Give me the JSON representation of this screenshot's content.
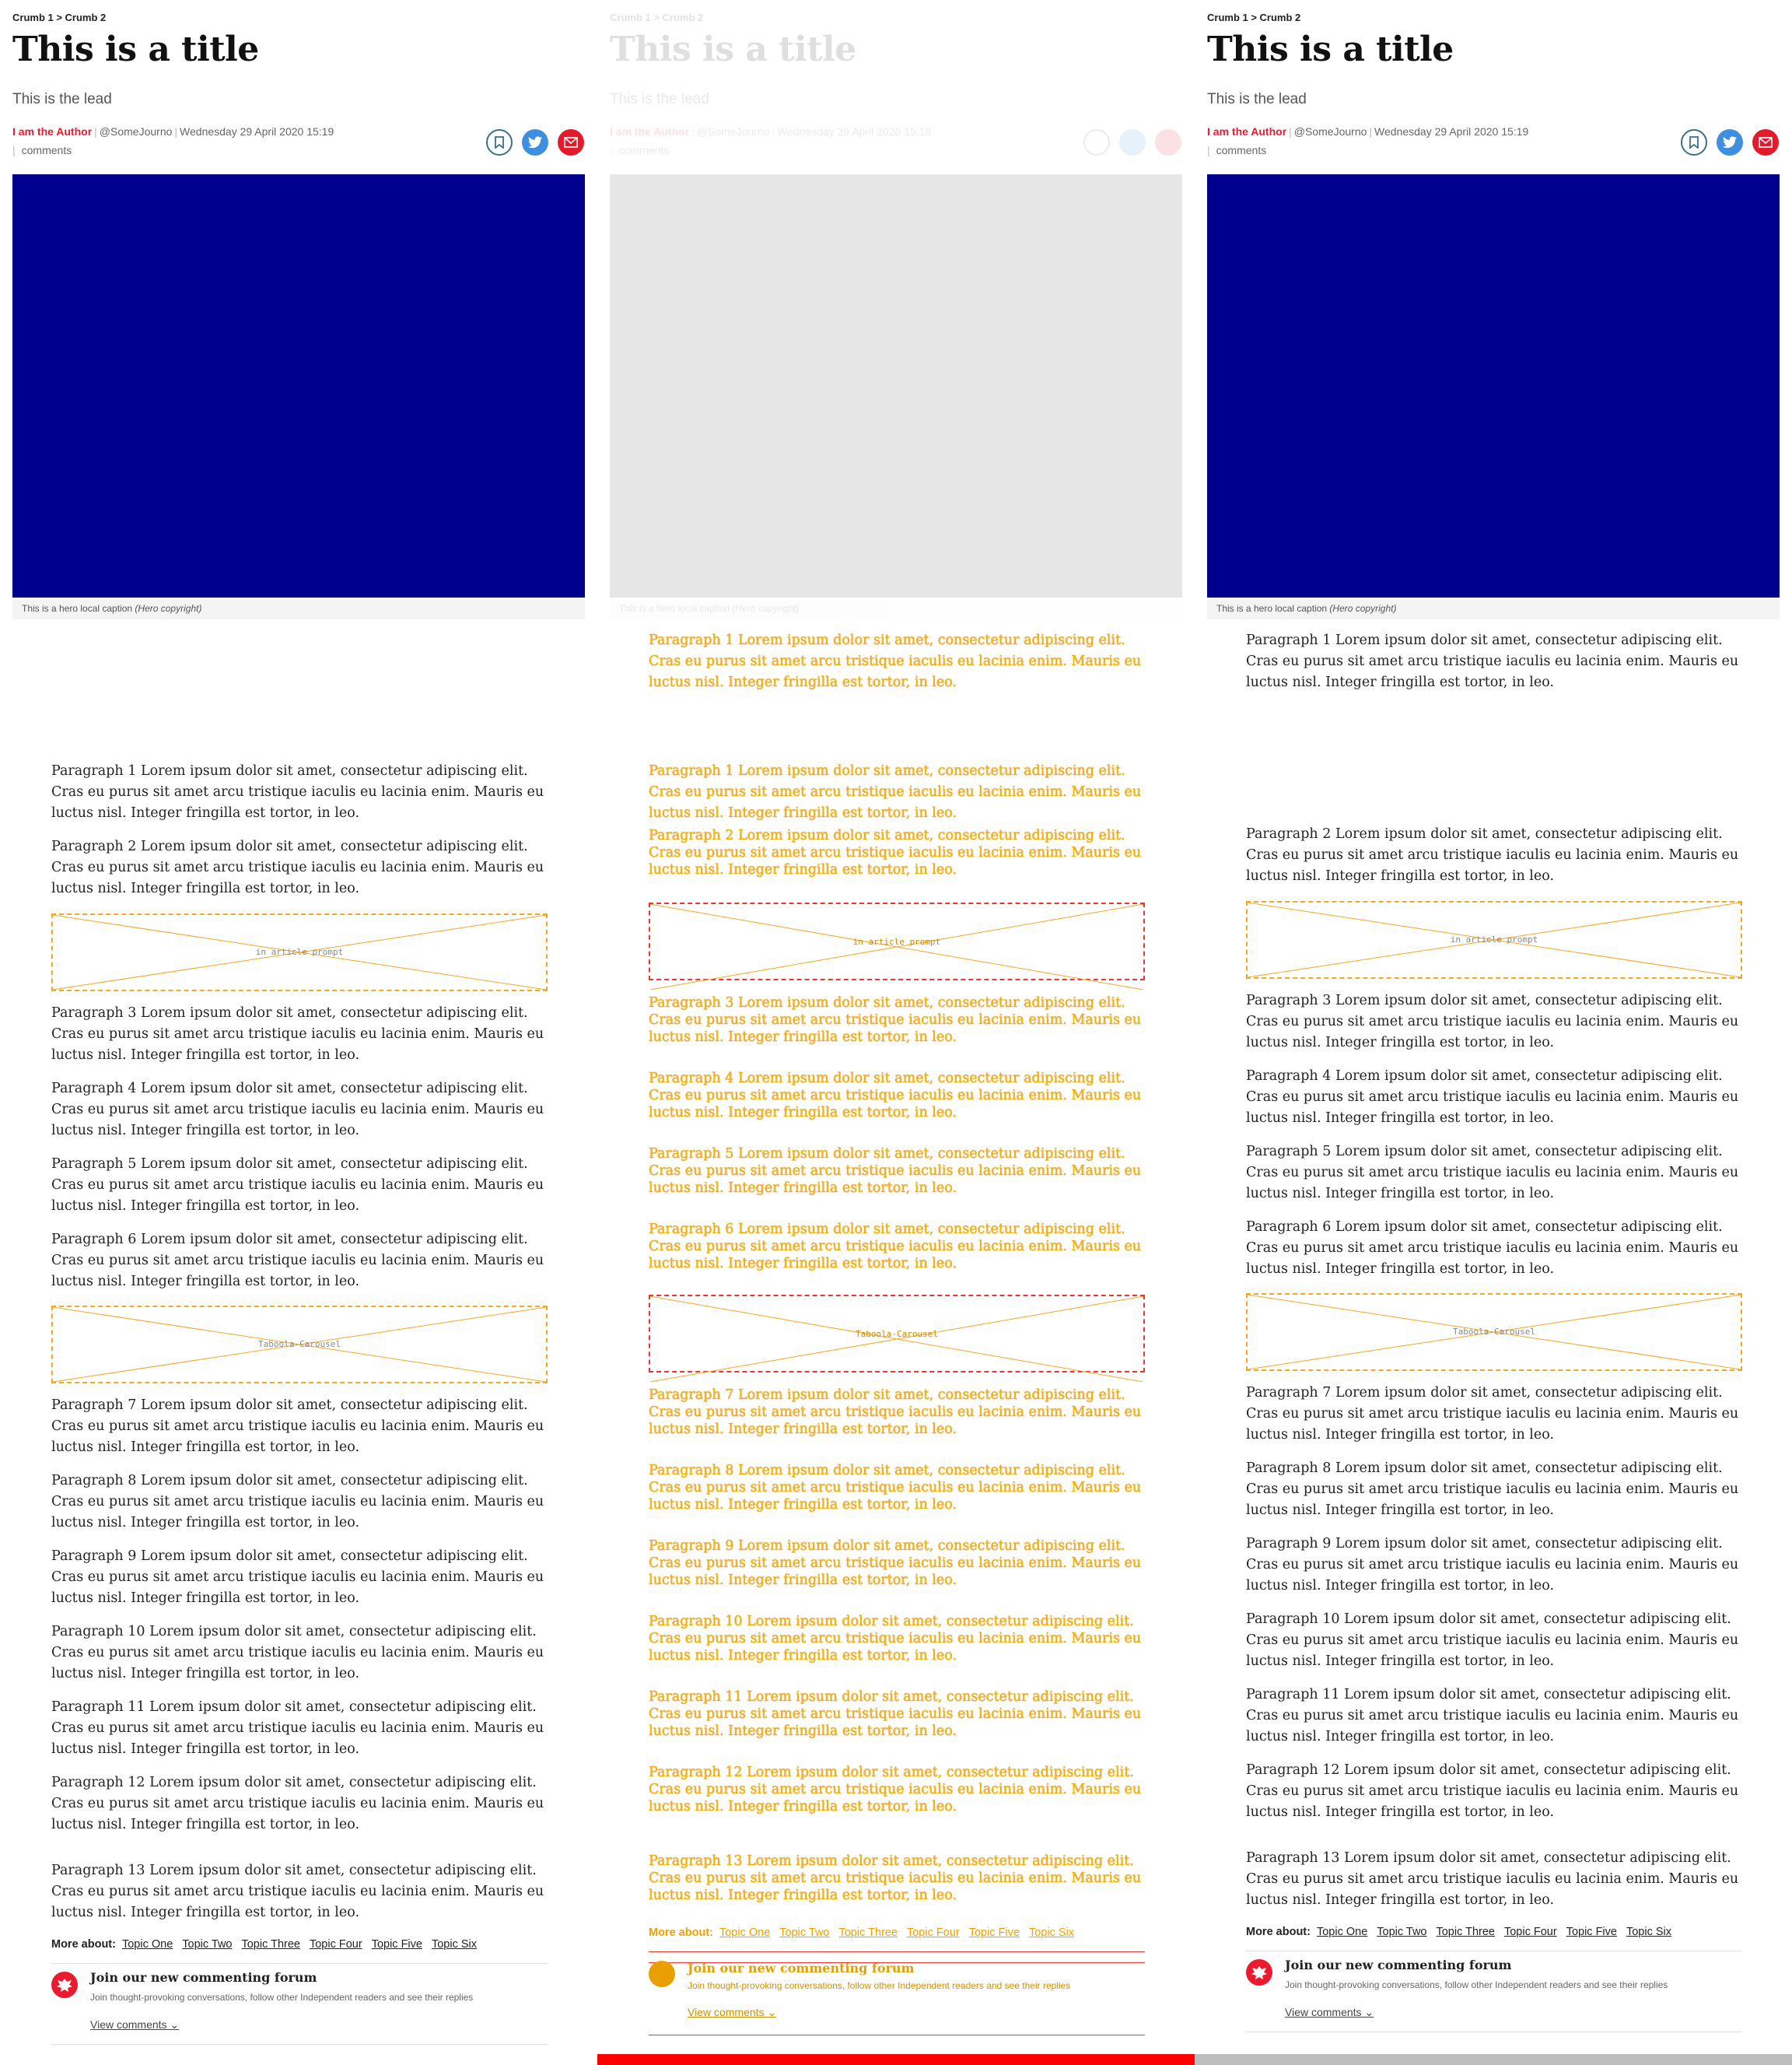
{
  "article": {
    "breadcrumb": "Crumb 1 > Crumb 2",
    "title": "This is a title",
    "lead": "This is the lead",
    "author": "I am the Author",
    "handle": "@SomeJourno",
    "date": "Wednesday 29 April 2020 15:19",
    "comments": "comments",
    "caption_text": "This is a hero local caption",
    "caption_copyright": "(Hero copyright)"
  },
  "share": {
    "bookmark_icon": "bookmark-icon",
    "twitter_icon": "twitter-icon",
    "email_icon": "email-icon",
    "colors": {
      "bookmark": "#3a6e8f",
      "twitter": "#3d8fe0",
      "email": "#e3192c"
    }
  },
  "colors": {
    "hero": "#00008f",
    "hero_placeholder": "#e6e6e6",
    "accent": "#ec1a2e",
    "placeholder_border": "#f5a623",
    "bottom_bar_red": "#ff0000",
    "bottom_bar_grey": "#bdbdbd"
  },
  "paragraphs": [
    "Paragraph 1 Lorem ipsum dolor sit amet, consectetur adipiscing elit. Cras eu purus sit amet arcu tristique iaculis eu lacinia enim. Mauris eu luctus nisl. Integer fringilla est tortor, in leo.",
    "Paragraph 2 Lorem ipsum dolor sit amet, consectetur adipiscing elit. Cras eu purus sit amet arcu tristique iaculis eu lacinia enim. Mauris eu luctus nisl. Integer fringilla est tortor, in leo.",
    "Paragraph 3 Lorem ipsum dolor sit amet, consectetur adipiscing elit. Cras eu purus sit amet arcu tristique iaculis eu lacinia enim. Mauris eu luctus nisl. Integer fringilla est tortor, in leo.",
    "Paragraph 4 Lorem ipsum dolor sit amet, consectetur adipiscing elit. Cras eu purus sit amet arcu tristique iaculis eu lacinia enim. Mauris eu luctus nisl. Integer fringilla est tortor, in leo.",
    "Paragraph 5 Lorem ipsum dolor sit amet, consectetur adipiscing elit. Cras eu purus sit amet arcu tristique iaculis eu lacinia enim. Mauris eu luctus nisl. Integer fringilla est tortor, in leo.",
    "Paragraph 6 Lorem ipsum dolor sit amet, consectetur adipiscing elit. Cras eu purus sit amet arcu tristique iaculis eu lacinia enim. Mauris eu luctus nisl. Integer fringilla est tortor, in leo.",
    "Paragraph 7 Lorem ipsum dolor sit amet, consectetur adipiscing elit. Cras eu purus sit amet arcu tristique iaculis eu lacinia enim. Mauris eu luctus nisl. Integer fringilla est tortor, in leo.",
    "Paragraph 8 Lorem ipsum dolor sit amet, consectetur adipiscing elit. Cras eu purus sit amet arcu tristique iaculis eu lacinia enim. Mauris eu luctus nisl. Integer fringilla est tortor, in leo.",
    "Paragraph 9 Lorem ipsum dolor sit amet, consectetur adipiscing elit. Cras eu purus sit amet arcu tristique iaculis eu lacinia enim. Mauris eu luctus nisl. Integer fringilla est tortor, in leo.",
    "Paragraph 10 Lorem ipsum dolor sit amet, consectetur adipiscing elit. Cras eu purus sit amet arcu tristique iaculis eu lacinia enim. Mauris eu luctus nisl. Integer fringilla est tortor, in leo.",
    "Paragraph 11 Lorem ipsum dolor sit amet, consectetur adipiscing elit. Cras eu purus sit amet arcu tristique iaculis eu lacinia enim. Mauris eu luctus nisl. Integer fringilla est tortor, in leo.",
    "Paragraph 12 Lorem ipsum dolor sit amet, consectetur adipiscing elit. Cras eu purus sit amet arcu tristique iaculis eu lacinia enim. Mauris eu luctus nisl. Integer fringilla est tortor, in leo.",
    "Paragraph 13 Lorem ipsum dolor sit amet, consectetur adipiscing elit. Cras eu purus sit amet arcu tristique iaculis eu lacinia enim. Mauris eu luctus nisl. Integer fringilla est tortor, in leo."
  ],
  "placeholders": {
    "prompt": "in article prompt",
    "carousel": "Taboola-Carousel"
  },
  "more_about": {
    "label": "More about:",
    "topics": [
      "Topic One",
      "Topic Two",
      "Topic Three",
      "Topic Four",
      "Topic Five",
      "Topic Six"
    ]
  },
  "forum": {
    "logo_icon": "independent-eagle-icon",
    "title": "Join our new commenting forum",
    "description": "Join thought-provoking conversations, follow other Independent readers and see their replies",
    "view_comments": "View comments",
    "chevron_icon": "chevron-down-icon"
  }
}
